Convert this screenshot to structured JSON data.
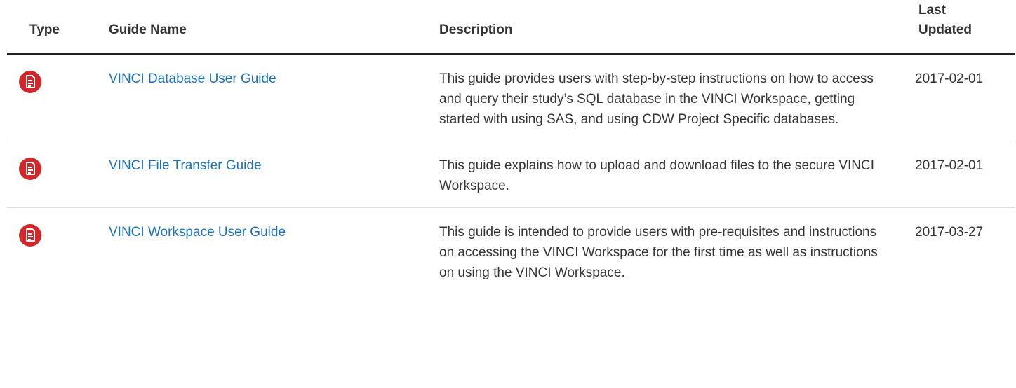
{
  "table": {
    "headers": {
      "type": "Type",
      "guide_name": "Guide Name",
      "description": "Description",
      "last_updated_line1": "Last",
      "last_updated_line2": "Updated"
    },
    "rows": [
      {
        "icon": "pdf-file-icon",
        "name": "VINCI Database User Guide",
        "description": "This guide provides users with step-by-step instructions on how to access and query their study’s SQL database in the VINCI Workspace, getting started with using SAS, and using CDW Project Specific databases.",
        "updated": "2017-02-01"
      },
      {
        "icon": "pdf-file-icon",
        "name": "VINCI File Transfer Guide",
        "description": "This guide explains how to upload and download files to the secure VINCI Workspace.",
        "updated": "2017-02-01"
      },
      {
        "icon": "pdf-file-icon",
        "name": "VINCI Workspace User Guide",
        "description": "This guide is intended to provide users with pre-requisites and instructions on accessing the VINCI Workspace for the first time as well as instructions on using the VINCI Workspace.",
        "updated": "2017-03-27"
      }
    ]
  },
  "colors": {
    "link": "#1a6fba",
    "icon_red": "#d1272a",
    "text": "#333333"
  }
}
